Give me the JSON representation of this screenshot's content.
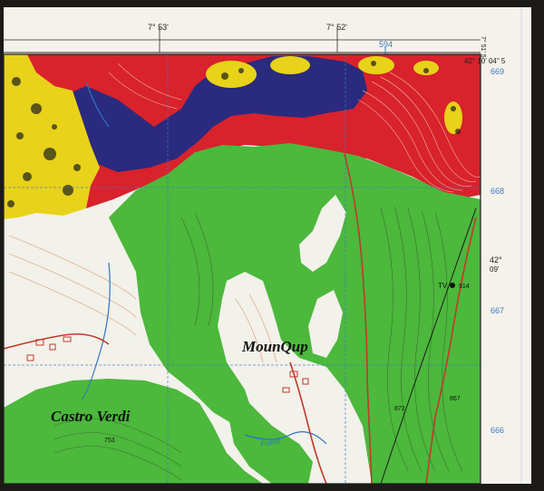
{
  "colors": {
    "frame": "#1c1a17",
    "paper": "#f4f2ea",
    "map_white": "#f2f1ea",
    "red_zone": "#d8222c",
    "blue_zone": "#2a2a7e",
    "yellow_zone": "#e8d21a",
    "green_zone": "#4cb83c",
    "grid": "#3b7bc4",
    "contour": "#c9743a",
    "contour_dark": "#2a3a18",
    "road": "#c0392b",
    "stream": "#2f73c0"
  },
  "map": {
    "longitude_labels": [
      "7° 53'",
      "7° 52'"
    ],
    "corner_latitude": "42° 10' 04\" 5",
    "corner_longitude": "7° 51' 5",
    "top_grid_number": "594",
    "right_grid_numbers": [
      "669",
      "668",
      "667",
      "666"
    ],
    "latitude_right_deg": "42°",
    "latitude_right_min": "09'",
    "place_labels": {
      "town_south_west": "Castro Verdi",
      "town_center": "MounQup"
    },
    "map_labels": {
      "tv_mast": "TV",
      "spot_height_914": "914",
      "spot_height_872": "872",
      "spot_height_867": "867",
      "spot_height_753": "753",
      "stream_name": "Fosso"
    }
  }
}
